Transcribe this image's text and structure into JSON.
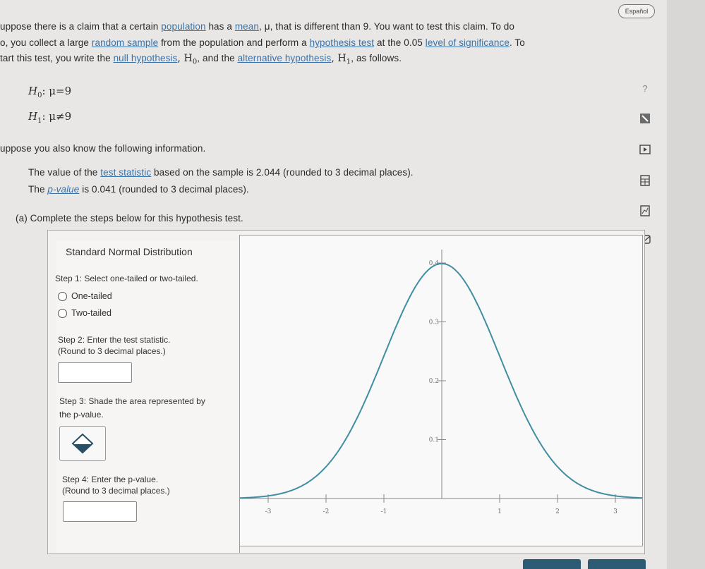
{
  "header": {
    "language_toggle": "Español"
  },
  "problem": {
    "line1_a": "uppose there is a claim that a certain ",
    "line1_link1": "population",
    "line1_b": " has a ",
    "line1_link2": "mean",
    "line1_c": ", μ, that is different than 9. You want to test this claim. To do",
    "line2_a": "o, you collect a large ",
    "line2_link1": "random sample",
    "line2_b": " from the population and perform a ",
    "line2_link2": "hypothesis test",
    "line2_c": " at the 0.05 ",
    "line2_link3": "level of significance",
    "line2_d": ". To",
    "line3_a": "tart this test, you write the ",
    "line3_link1": "null hypothesis",
    "line3_b": ", H",
    "line3_sub1": "0",
    "line3_c": ", and the ",
    "line3_link2": "alternative hypothesis",
    "line3_d": ", H",
    "line3_sub2": "1",
    "line3_e": ", as follows."
  },
  "hypotheses": {
    "h0_label": "H",
    "h0_sub": "0",
    "h0_rel": ": μ=9",
    "h1_label": "H",
    "h1_sub": "1",
    "h1_rel": ": μ≠9"
  },
  "info": {
    "intro": "uppose you also know the following information.",
    "ts_a": "The value of the ",
    "ts_link": "test statistic",
    "ts_b": " based on the sample is 2.044 (rounded to 3 decimal places).",
    "pv_a": "The ",
    "pv_link": "p-value",
    "pv_b": " is 0.041 (rounded to 3 decimal places)."
  },
  "part_a": "(a)  Complete the steps below for this hypothesis test.",
  "panel": {
    "title": "Standard Normal Distribution",
    "step1": "Step 1: Select one-tailed or two-tailed.",
    "option1": "One-tailed",
    "option2": "Two-tailed",
    "step2_line1": "Step 2: Enter the test statistic.",
    "step2_line2": "(Round to 3 decimal places.)",
    "step3_line1": "Step 3: Shade the area represented by",
    "step3_line2": "the p-value.",
    "step4_line1": "Step 4: Enter the p-value.",
    "step4_line2": "(Round to 3 decimal places.)"
  },
  "chart_data": {
    "type": "line",
    "title": "Standard Normal Distribution",
    "x_ticks": [
      "-3",
      "-2",
      "-1",
      "1",
      "2",
      "3"
    ],
    "y_ticks": [
      "0.1",
      "0.2",
      "0.3",
      "0.4"
    ],
    "xlim": [
      -3.5,
      3.5
    ],
    "ylim": [
      0,
      0.42
    ],
    "series": [
      {
        "function": "standard normal pdf",
        "mean": 0,
        "sd": 1
      }
    ],
    "line_color": "#3f8ea3"
  },
  "toolbar_icons": [
    "help-icon",
    "calculator-icon",
    "video-icon",
    "table-icon",
    "chart-icon",
    "mail-icon"
  ],
  "toolbar_labels": {
    "help": "?"
  }
}
